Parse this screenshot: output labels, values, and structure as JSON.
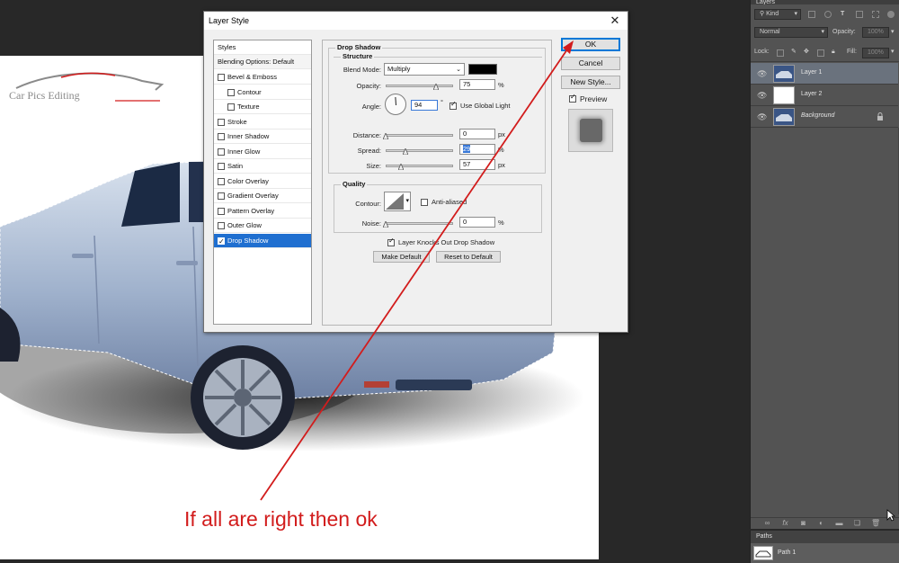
{
  "dialog": {
    "title": "Layer Style",
    "close_glyph": "✕",
    "styles_list": {
      "header": "Styles",
      "blending_options": "Blending Options: Default",
      "items": [
        {
          "label": "Bevel & Emboss",
          "checked": false,
          "indent": false
        },
        {
          "label": "Contour",
          "checked": false,
          "indent": true
        },
        {
          "label": "Texture",
          "checked": false,
          "indent": true
        },
        {
          "label": "Stroke",
          "checked": false,
          "indent": false
        },
        {
          "label": "Inner Shadow",
          "checked": false,
          "indent": false
        },
        {
          "label": "Inner Glow",
          "checked": false,
          "indent": false
        },
        {
          "label": "Satin",
          "checked": false,
          "indent": false
        },
        {
          "label": "Color Overlay",
          "checked": false,
          "indent": false
        },
        {
          "label": "Gradient Overlay",
          "checked": false,
          "indent": false
        },
        {
          "label": "Pattern Overlay",
          "checked": false,
          "indent": false
        },
        {
          "label": "Outer Glow",
          "checked": false,
          "indent": false
        },
        {
          "label": "Drop Shadow",
          "checked": true,
          "indent": false,
          "selected": true
        }
      ]
    },
    "drop_shadow": {
      "section_title": "Drop Shadow",
      "structure_title": "Structure",
      "blend_mode_label": "Blend Mode:",
      "blend_mode_value": "Multiply",
      "shadow_color": "#000000",
      "opacity_label": "Opacity:",
      "opacity_value": "75",
      "opacity_fraction": 0.75,
      "angle_label": "Angle:",
      "angle_value": "94",
      "degree_symbol": "°",
      "use_global_light_label": "Use Global Light",
      "use_global_light": true,
      "distance_label": "Distance:",
      "distance_value": "0",
      "distance_fraction": 0.0,
      "spread_label": "Spread:",
      "spread_value": "29",
      "spread_fraction": 0.29,
      "size_label": "Size:",
      "size_value": "57",
      "size_fraction": 0.23,
      "px_unit": "px",
      "percent_unit": "%",
      "quality_title": "Quality",
      "contour_label": "Contour:",
      "anti_aliased_label": "Anti-aliased",
      "anti_aliased": false,
      "noise_label": "Noise:",
      "noise_value": "0",
      "noise_fraction": 0.0,
      "knocks_out_label": "Layer Knocks Out Drop Shadow",
      "knocks_out": true,
      "make_default_label": "Make Default",
      "reset_default_label": "Reset to Default"
    },
    "buttons": {
      "ok": "OK",
      "cancel": "Cancel",
      "new_style": "New Style...",
      "preview_label": "Preview",
      "preview_checked": true
    }
  },
  "layers_panel": {
    "tab_label": "Layers",
    "kind_filter": "Kind",
    "blend_mode": "Normal",
    "opacity_label": "Opacity:",
    "opacity_value": "100%",
    "lock_label": "Lock:",
    "fill_label": "Fill:",
    "fill_value": "100%",
    "layers": [
      {
        "name": "Layer 1",
        "active": true,
        "thumb": "car",
        "italic": false,
        "locked": false
      },
      {
        "name": "Layer 2",
        "active": false,
        "thumb": "white",
        "italic": false,
        "locked": false
      },
      {
        "name": "Background",
        "active": false,
        "thumb": "car",
        "italic": true,
        "locked": true
      }
    ],
    "footer_icons": [
      "link-icon",
      "fx-icon",
      "mask-icon",
      "adjustment-icon",
      "folder-icon",
      "new-layer-icon",
      "trash-icon"
    ]
  },
  "paths_panel": {
    "tab_label": "Paths",
    "path_name": "Path 1"
  },
  "canvas": {
    "watermark_text": "Car Pics Editing",
    "caption": "If all are right then ok",
    "accent_color": "#d21c1c"
  }
}
